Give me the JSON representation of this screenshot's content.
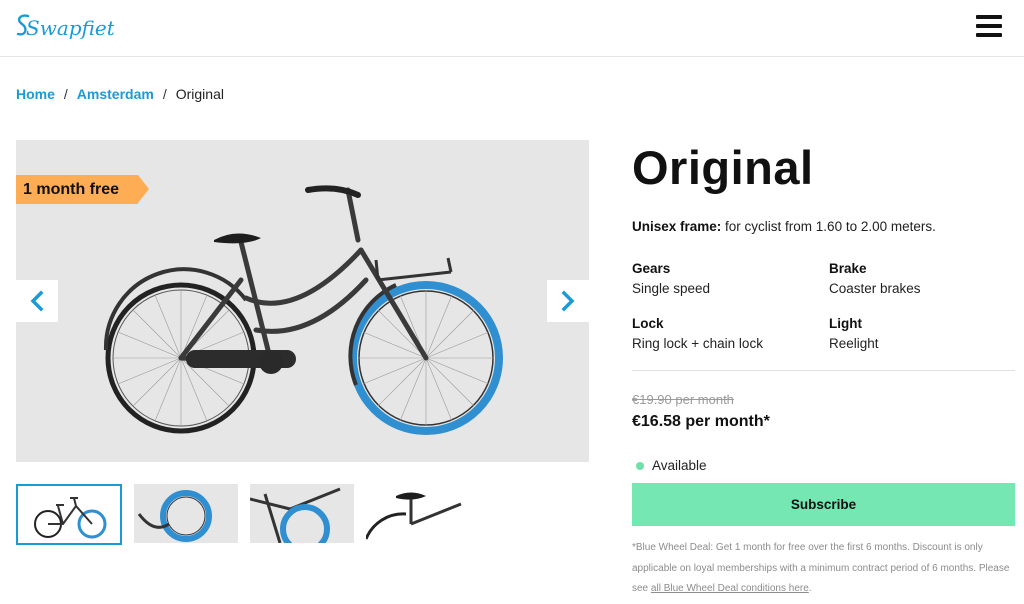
{
  "header": {
    "logo_text": "Swapfiets",
    "brand_color": "#1a9bd7",
    "menu_icon": "hamburger-menu-icon"
  },
  "breadcrumb": {
    "items": [
      {
        "label": "Home",
        "link": true
      },
      {
        "label": "Amsterdam",
        "link": true
      },
      {
        "label": "Original",
        "link": false
      }
    ],
    "separator": "/"
  },
  "gallery": {
    "badge": "1 month free",
    "badge_color": "#ffad55",
    "prev_icon": "chevron-left-icon",
    "next_icon": "chevron-right-icon",
    "thumbnails": [
      {
        "name": "full-bike",
        "active": true
      },
      {
        "name": "front-wheel",
        "active": false
      },
      {
        "name": "front-carrier",
        "active": false
      },
      {
        "name": "saddle-rear",
        "active": false
      }
    ]
  },
  "product": {
    "title": "Original",
    "frame_label": "Unisex frame:",
    "frame_text": " for cyclist from 1.60 to 2.00 meters.",
    "specs": [
      {
        "key": "Gears",
        "value": "Single speed"
      },
      {
        "key": "Brake",
        "value": "Coaster brakes"
      },
      {
        "key": "Lock",
        "value": "Ring lock + chain lock"
      },
      {
        "key": "Light",
        "value": "Reelight"
      }
    ],
    "old_price": "€19.90 per month",
    "price": "€16.58 per month*",
    "availability": "Available",
    "availability_color": "#6ee1aa",
    "subscribe_label": "Subscribe",
    "subscribe_color": "#74e7b2",
    "fine_print": "*Blue Wheel Deal: Get 1 month for free over the first 6 months. Discount is only applicable on loyal memberships with a minimum contract period of 6 months. Please see ",
    "fine_link": "all Blue Wheel Deal conditions here",
    "fine_end": "."
  }
}
